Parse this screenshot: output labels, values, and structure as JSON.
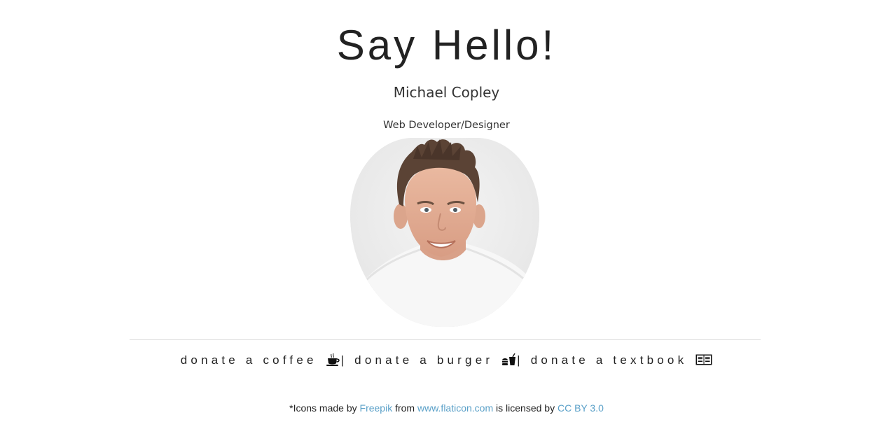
{
  "header": {
    "title": "Say Hello!",
    "name": "Michael Copley",
    "role": "Web Developer/Designer"
  },
  "avatar": {
    "alt": "Michael Copley"
  },
  "donate": {
    "coffee_label": "donate a coffee",
    "coffee_icon": "coffee-cup-icon",
    "separator": "|",
    "burger_label": "donate a burger",
    "burger_icon": "burger-drink-icon",
    "textbook_label": "donate a textbook",
    "textbook_icon": "open-book-icon"
  },
  "credits": {
    "prefix": "*Icons made by",
    "author_link": "Freepik",
    "from_text": "from",
    "site_link": "www.flaticon.com",
    "licensed_text": "is licensed by",
    "license_link": "CC BY 3.0"
  },
  "colors": {
    "text": "#222222",
    "link": "#5aa0c8",
    "divider": "#dddddd",
    "background": "#ffffff"
  }
}
